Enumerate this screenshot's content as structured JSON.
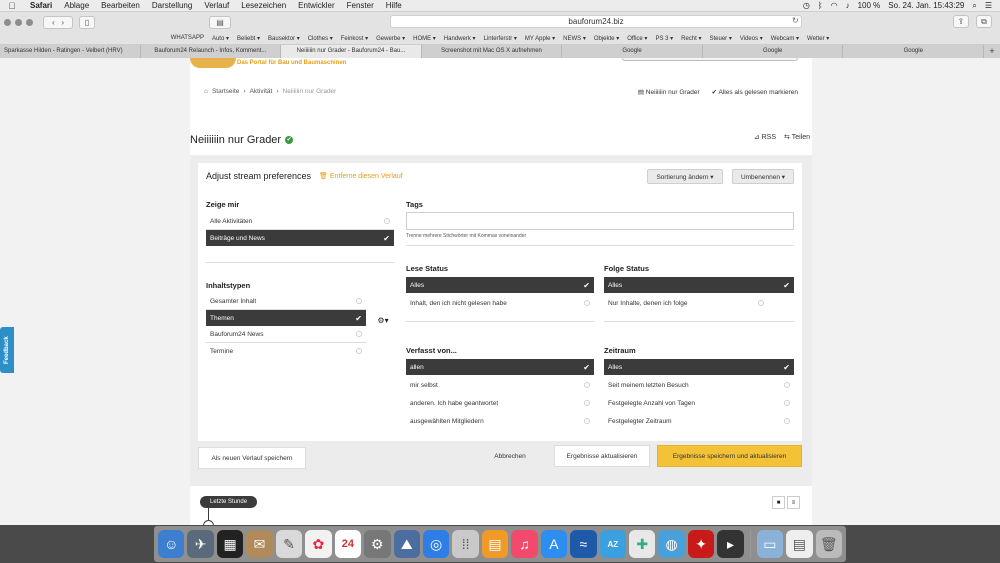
{
  "menubar": {
    "app_name": "Safari",
    "items": [
      "Ablage",
      "Bearbeiten",
      "Darstellung",
      "Verlauf",
      "Lesezeichen",
      "Entwickler",
      "Fenster",
      "Hilfe"
    ],
    "clock": "So. 24. Jan.  15:43:29",
    "battery": "100 %"
  },
  "toolbar": {
    "url": "bauforum24.biz"
  },
  "bookmarks": [
    "WHATSAPP",
    "Auto ▾",
    "Beliebt ▾",
    "Bausektor ▾",
    "Clothes ▾",
    "Feinkost ▾",
    "Gewerbe ▾",
    "HOME ▾",
    "Handwerk ▾",
    "Linterferstr ▾",
    "MY Apple ▾",
    "NEWS ▾",
    "Objekte ▾",
    "Office ▾",
    "PS 3 ▾",
    "Recht ▾",
    "Steuer ▾",
    "Videos ▾",
    "Webcam ▾",
    "Wetter ▾"
  ],
  "tabs": [
    {
      "label": "Sparkasse Hilden - Ratingen - Velbert (HRV)",
      "active": false
    },
    {
      "label": "Bauforum24 Relaunch - Infos, Komment...",
      "active": false
    },
    {
      "label": "Neiiiiiin nur Grader - Bauforum24 - Bau...",
      "active": true
    },
    {
      "label": "Screenshot mit Mac OS X aufnehmen",
      "active": false
    },
    {
      "label": "Google",
      "active": false
    },
    {
      "label": "Google",
      "active": false
    },
    {
      "label": "Google",
      "active": false
    }
  ],
  "site": {
    "tagline": "Das Portal für Bau und Baumaschinen",
    "breadcrumb": [
      "Startseite",
      "Aktivität",
      "Neiiiiiin nur Grader"
    ],
    "crumb_actions": [
      "Neiiiiiin nur Grader",
      "Alles als gelesen markieren"
    ],
    "page_title": "Neiiiiiin nur Grader",
    "rss": "RSS",
    "share": "Teilen",
    "feedback": "Feedback"
  },
  "prefs": {
    "title": "Adjust stream preferences",
    "remove": "Entferne diesen Verlauf",
    "sort_btn": "Sortierung ändern ▾",
    "rename_btn": "Umbenennen ▾",
    "show_me": {
      "label": "Zeige mir",
      "options": [
        {
          "label": "Alle Aktivitäten",
          "selected": false
        },
        {
          "label": "Beiträge und News",
          "selected": true
        }
      ]
    },
    "content_types": {
      "label": "Inhaltstypen",
      "options": [
        {
          "label": "Gesamter Inhalt",
          "selected": false
        },
        {
          "label": "Themen",
          "selected": true
        },
        {
          "label": "Bauforum24 News",
          "selected": false
        },
        {
          "label": "Termine",
          "selected": false
        }
      ]
    },
    "tags": {
      "label": "Tags",
      "value": "",
      "help": "Trenne mehrere Stichwörter mit Kommas voneinander"
    },
    "read_status": {
      "label": "Lese Status",
      "options": [
        {
          "label": "Alles",
          "selected": true
        },
        {
          "label": "Inhalt, den ich nicht gelesen habe",
          "selected": false
        }
      ]
    },
    "follow_status": {
      "label": "Folge Status",
      "options": [
        {
          "label": "Alles",
          "selected": true
        },
        {
          "label": "Nur Inhalte, denen ich folge",
          "selected": false
        }
      ]
    },
    "written_by": {
      "label": "Verfasst von...",
      "options": [
        {
          "label": "allen",
          "selected": true
        },
        {
          "label": "mir selbst",
          "selected": false
        },
        {
          "label": "anderen. Ich habe geantwortet",
          "selected": false
        },
        {
          "label": "ausgewählten Mitgliedern",
          "selected": false
        }
      ]
    },
    "timeframe": {
      "label": "Zeitraum",
      "options": [
        {
          "label": "Alles",
          "selected": true
        },
        {
          "label": "Seit meinem letzten Besuch",
          "selected": false
        },
        {
          "label": "Festgelegte Anzahl von Tagen",
          "selected": false
        },
        {
          "label": "Festgelegter Zeitraum",
          "selected": false
        }
      ]
    },
    "buttons": {
      "save_new": "Als neuen Verlauf speichern",
      "cancel": "Abbrechen",
      "update": "Ergebnisse aktualisieren",
      "save_update": "Ergebnisse speichern und aktualisieren"
    }
  },
  "timeline": {
    "label": "Letzte Stunde"
  },
  "colors": {
    "accent": "#f3c237",
    "selected_row": "#3b3b3b",
    "feedback_tab": "#2d8fc8"
  }
}
